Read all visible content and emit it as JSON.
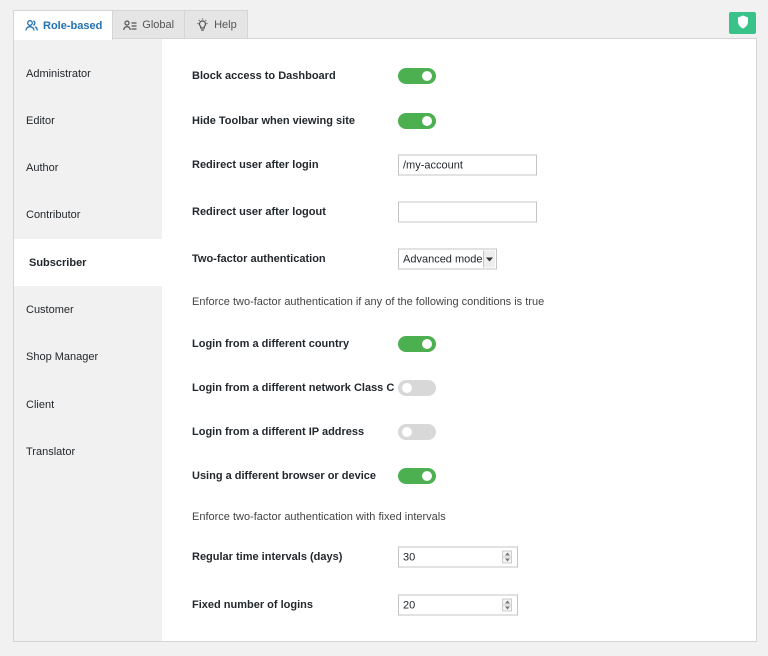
{
  "tabs": [
    {
      "label": "Role-based",
      "icon": "users-icon",
      "active": true
    },
    {
      "label": "Global",
      "icon": "list-user-icon",
      "active": false
    },
    {
      "label": "Help",
      "icon": "lightbulb-icon",
      "active": false
    }
  ],
  "shield_button": {
    "icon": "shield-icon",
    "color": "#3ac28b"
  },
  "sidebar": {
    "items": [
      {
        "label": "Administrator"
      },
      {
        "label": "Editor"
      },
      {
        "label": "Author"
      },
      {
        "label": "Contributor"
      },
      {
        "label": "Subscriber",
        "active": true
      },
      {
        "label": "Customer"
      },
      {
        "label": "Shop Manager"
      },
      {
        "label": "Client"
      },
      {
        "label": "Translator"
      }
    ]
  },
  "settings": {
    "block_dashboard": {
      "label": "Block access to Dashboard",
      "on": true
    },
    "hide_toolbar": {
      "label": "Hide Toolbar when viewing site",
      "on": true
    },
    "redirect_login": {
      "label": "Redirect user after login",
      "value": "/my-account"
    },
    "redirect_logout": {
      "label": "Redirect user after logout",
      "value": ""
    },
    "two_factor": {
      "label": "Two-factor authentication",
      "value": "Advanced mode"
    },
    "conditions_note": "Enforce two-factor authentication if any of the following conditions is true",
    "diff_country": {
      "label": "Login from a different country",
      "on": true
    },
    "diff_network": {
      "label": "Login from a different network Class C",
      "on": false
    },
    "diff_ip": {
      "label": "Login from a different IP address",
      "on": false
    },
    "diff_browser": {
      "label": "Using a different browser or device",
      "on": true
    },
    "intervals_note": "Enforce two-factor authentication with fixed intervals",
    "time_interval": {
      "label": "Regular time intervals (days)",
      "value": "30"
    },
    "login_count": {
      "label": "Fixed number of logins",
      "value": "20"
    }
  },
  "colors": {
    "toggle_on": "#4caf50",
    "toggle_off": "#d8d8d8",
    "accent": "#2271b1"
  }
}
